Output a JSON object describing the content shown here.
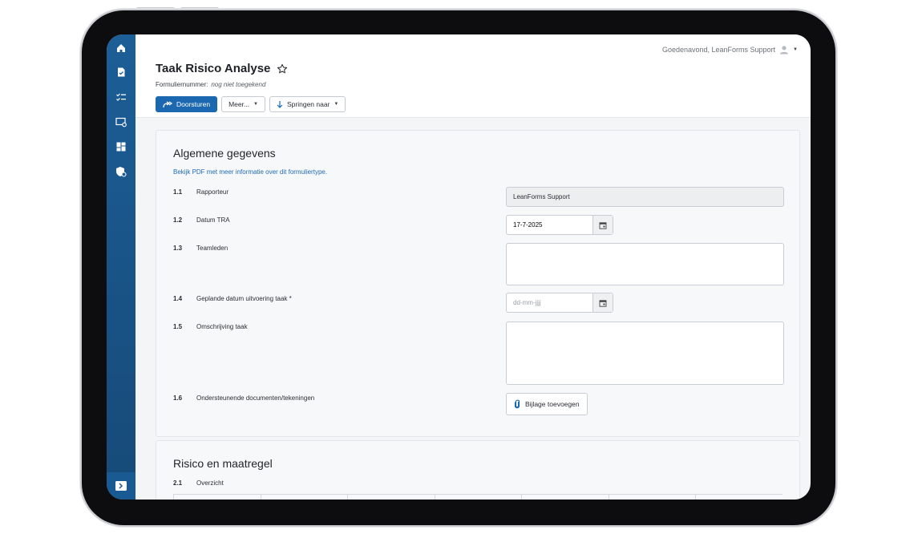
{
  "header": {
    "greeting": "Goedenavond, LeanForms Support",
    "title": "Taak Risico Analyse",
    "form_number_label": "Formuliernummer:",
    "form_number_value": "nog niet toegekend"
  },
  "toolbar": {
    "forward_label": "Doorsturen",
    "more_label": "Meer...",
    "jump_label": "Springen naar"
  },
  "sidebar": {
    "icons": [
      "home-icon",
      "document-icon",
      "checklist-icon",
      "screen-settings-icon",
      "dashboard-icon",
      "shield-settings-icon"
    ],
    "expand_icon": "expand-icon"
  },
  "section1": {
    "title": "Algemene gegevens",
    "pdf_link": "Bekijk PDF met meer informatie over dit formuliertype.",
    "rows": [
      {
        "num": "1.1",
        "label": "Rapporteur",
        "value": "LeanForms Support"
      },
      {
        "num": "1.2",
        "label": "Datum TRA",
        "value": "17-7-2025"
      },
      {
        "num": "1.3",
        "label": "Teamleden",
        "value": ""
      },
      {
        "num": "1.4",
        "label": "Geplande datum uitvoering taak *",
        "placeholder": "dd-mm-jjjj"
      },
      {
        "num": "1.5",
        "label": "Omschrijving taak",
        "value": ""
      },
      {
        "num": "1.6",
        "label": "Ondersteunende documenten/tekeningen",
        "button": "Bijlage toevoegen"
      }
    ]
  },
  "section2": {
    "title": "Risico en maatregel",
    "rows": [
      {
        "num": "2.1",
        "label": "Overzicht"
      }
    ]
  },
  "colors": {
    "sidebar": "#1c5e97",
    "primary": "#1b68b0",
    "link": "#1e6bb8"
  }
}
